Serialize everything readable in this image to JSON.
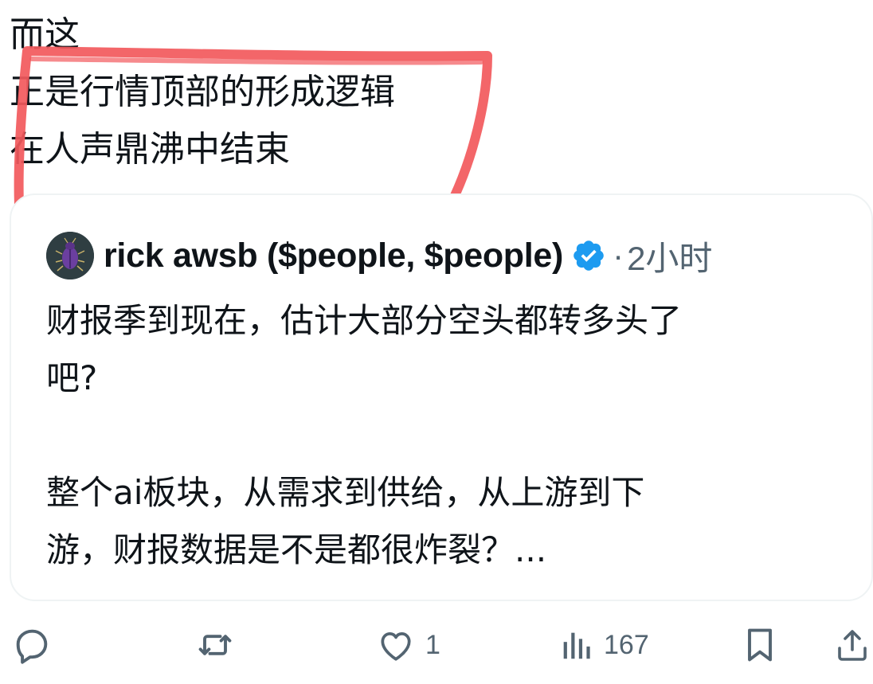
{
  "post": {
    "lines": [
      "而这",
      "正是行情顶部的形成逻辑",
      "在人声鼎沸中结束"
    ]
  },
  "highlight": {
    "color": "#f2595c"
  },
  "quote": {
    "author_name": "rick awsb ($people, $people)",
    "verified_color": "#1d9bf0",
    "separator": "·",
    "time": "2小时",
    "lines_para1": [
      "财报季到现在，估计大部分空头都转多头了",
      "吧?"
    ],
    "lines_para2": [
      "整个ai板块，从需求到供给，从上游到下",
      "游，财报数据是不是都很炸裂？..."
    ]
  },
  "actions": {
    "reply_icon": "reply-icon",
    "retweet_icon": "retweet-icon",
    "like_icon": "heart-icon",
    "like_count": "1",
    "views_icon": "views-icon",
    "views_count": "167",
    "bookmark_icon": "bookmark-icon",
    "share_icon": "share-icon"
  },
  "colors": {
    "text": "#0f1419",
    "secondary": "#536471",
    "card_border": "#eff3f4"
  }
}
